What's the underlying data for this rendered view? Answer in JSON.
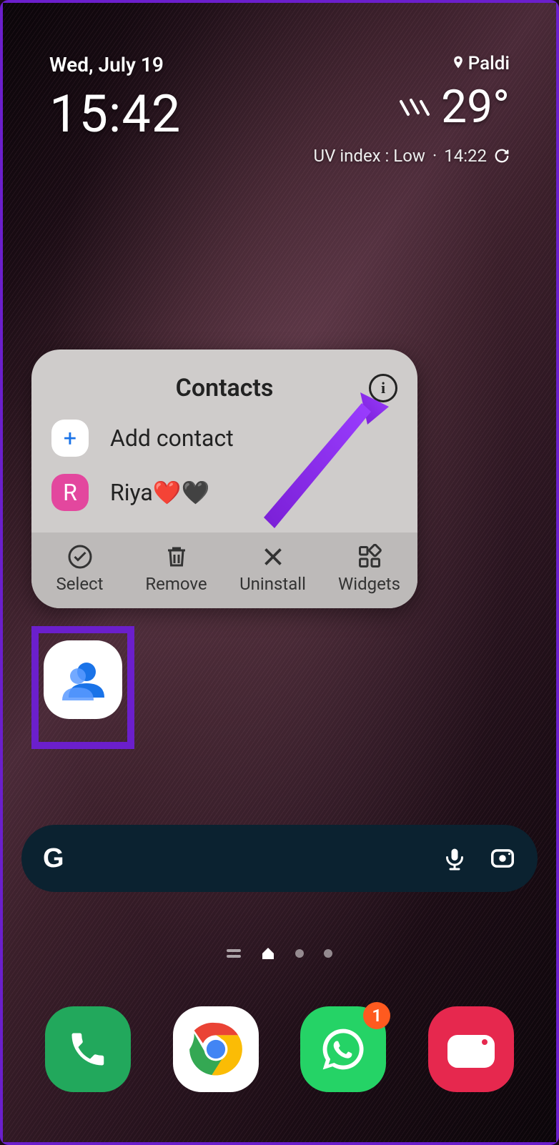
{
  "status": {
    "date": "Wed, July 19",
    "time": "15:42",
    "location": "Paldi",
    "temperature": "29°",
    "uv_label": "UV index : Low",
    "update_time": "14:22"
  },
  "popup": {
    "title": "Contacts",
    "info_glyph": "i",
    "items": [
      {
        "icon_type": "add",
        "icon_text": "+",
        "label": "Add contact"
      },
      {
        "icon_type": "avatar",
        "icon_text": "R",
        "label": "Riya❤️🖤"
      }
    ],
    "actions": [
      {
        "icon": "select",
        "label": "Select"
      },
      {
        "icon": "remove",
        "label": "Remove"
      },
      {
        "icon": "uninstall",
        "label": "Uninstall"
      },
      {
        "icon": "widgets",
        "label": "Widgets"
      }
    ]
  },
  "search": {
    "g": "G"
  },
  "dock": {
    "apps": [
      "Phone",
      "Chrome",
      "WhatsApp",
      "Camera"
    ],
    "whatsapp_badge": "1"
  }
}
